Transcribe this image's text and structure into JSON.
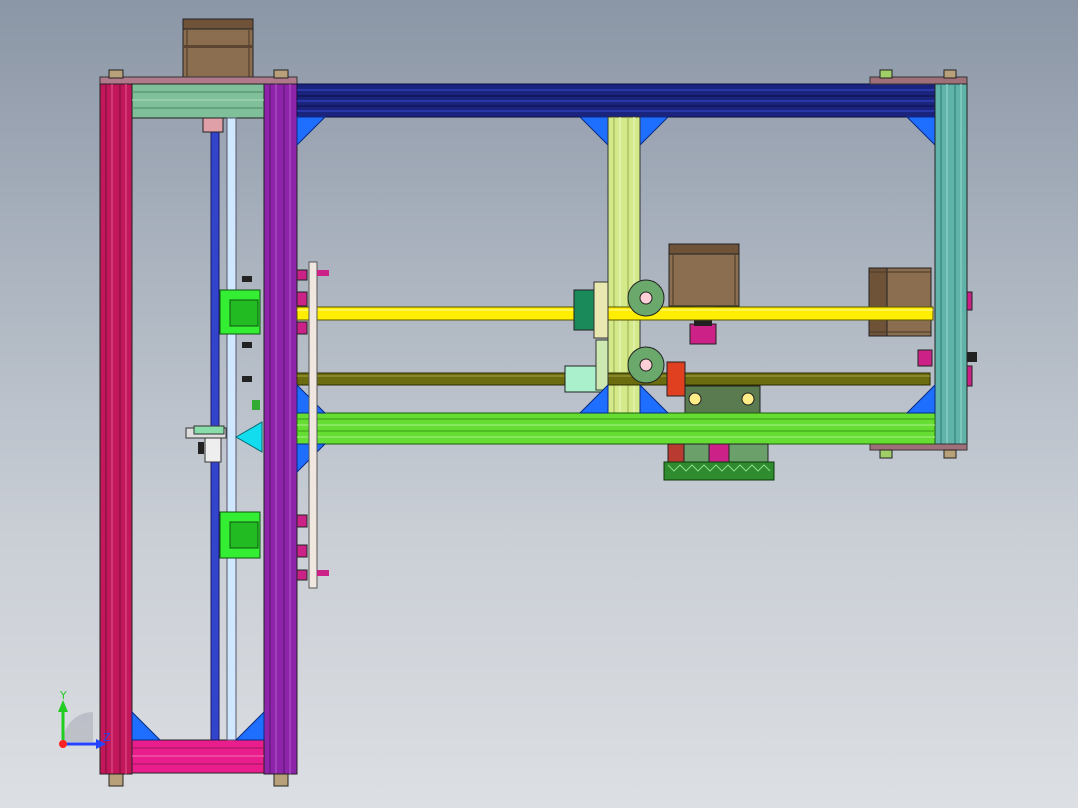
{
  "viewport": {
    "background_top": "#8b96a6",
    "background_bottom": "#dcdfe3"
  },
  "triad": {
    "y_label": "Y",
    "z_label": "Z",
    "y_color": "#22cc22",
    "z_color": "#2244ff",
    "x_color": "#ff2222"
  },
  "colors": {
    "left_outer_rail": "#c2185b",
    "left_inner_rail": "#8e24aa",
    "top_beam": "#1a237e",
    "right_post": "#5fb3a8",
    "middle_post": "#d4e98a",
    "gantry_beam": "#66dd33",
    "yellow_rod": "#ffee00",
    "olive_rod": "#6b6b10",
    "stepper_motor": "#8b6d4f",
    "corner_bracket": "#1e6fff",
    "slider_block": "#33ee33",
    "bottom_beam": "#e91e8c",
    "gear": "#2e8b2e",
    "nozzle": "#11ddee"
  }
}
